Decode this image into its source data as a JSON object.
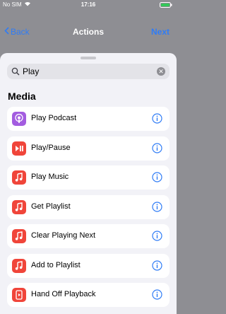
{
  "status": {
    "carrier": "No SIM",
    "time": "17:16"
  },
  "nav": {
    "back_label": "Back",
    "title": "Actions",
    "next_label": "Next"
  },
  "search": {
    "value": "Play"
  },
  "section": {
    "title": "Media"
  },
  "actions": [
    {
      "label": "Play Podcast",
      "icon": "podcasts-icon",
      "color": "#a35ce0"
    },
    {
      "label": "Play/Pause",
      "icon": "play-pause-icon",
      "color": "#f0453a"
    },
    {
      "label": "Play Music",
      "icon": "music-note-icon",
      "color": "#f0453a"
    },
    {
      "label": "Get Playlist",
      "icon": "music-note-icon",
      "color": "#f0453a"
    },
    {
      "label": "Clear Playing Next",
      "icon": "music-note-icon",
      "color": "#f0453a"
    },
    {
      "label": "Add to Playlist",
      "icon": "music-note-icon",
      "color": "#f0453a"
    },
    {
      "label": "Hand Off Playback",
      "icon": "handoff-icon",
      "color": "#f0453a"
    }
  ],
  "colors": {
    "accent": "#2f7cf6",
    "sheet": "#f2f2f7"
  }
}
